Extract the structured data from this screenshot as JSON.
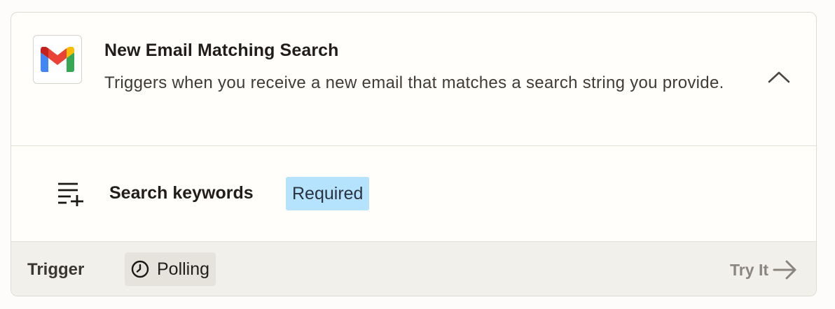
{
  "trigger": {
    "app_icon": "gmail-icon",
    "title": "New Email Matching Search",
    "description": "Triggers when you receive a new email that matches a search string you provide.",
    "collapse_icon": "chevron-up-icon"
  },
  "fields": [
    {
      "icon": "add-list-icon",
      "label": "Search keywords",
      "badge": "Required",
      "badge_color": "#b5e2fc"
    }
  ],
  "footer": {
    "type_label": "Trigger",
    "polling_icon": "clock-icon",
    "polling_label": "Polling",
    "try_it_label": "Try It",
    "try_it_icon": "arrow-right-icon"
  },
  "colors": {
    "gmail_red": "#ea4335",
    "gmail_blue": "#4285f4",
    "gmail_green": "#34a853",
    "gmail_yellow": "#fbbc04",
    "gmail_dark_red": "#c5221f"
  }
}
